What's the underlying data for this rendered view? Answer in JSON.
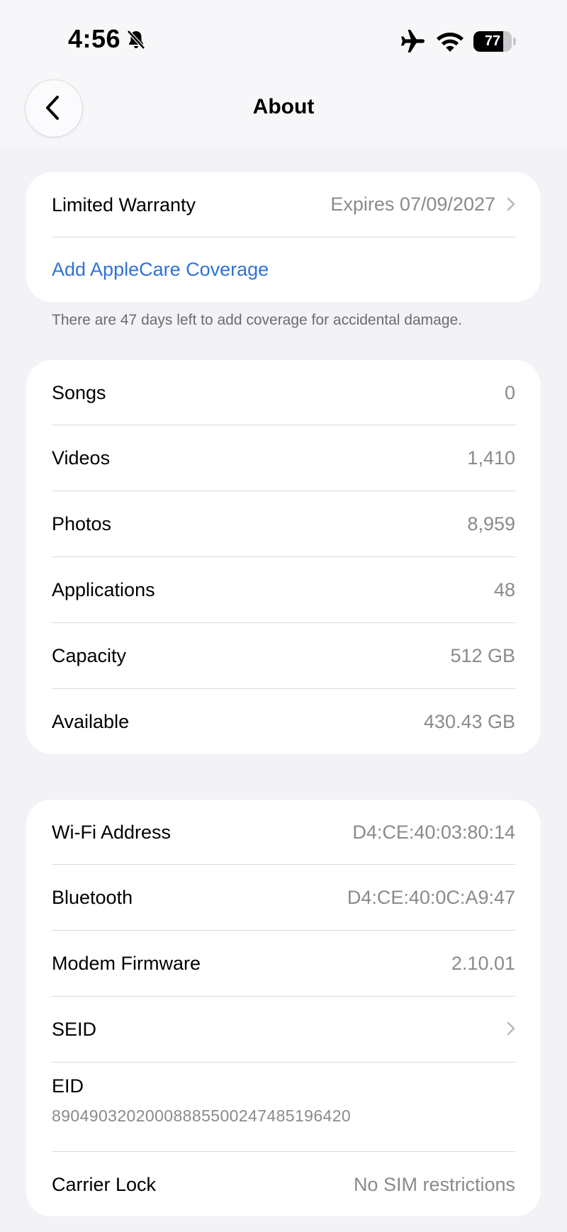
{
  "status": {
    "time": "4:56",
    "battery": "77",
    "battery_level": 0.77
  },
  "nav": {
    "title": "About"
  },
  "warranty": {
    "label": "Limited Warranty",
    "value": "Expires 07/09/2027",
    "applecare_link": "Add AppleCare Coverage",
    "footnote": "There are 47 days left to add coverage for accidental damage."
  },
  "media": {
    "rows": [
      {
        "label": "Songs",
        "value": "0"
      },
      {
        "label": "Videos",
        "value": "1,410"
      },
      {
        "label": "Photos",
        "value": "8,959"
      },
      {
        "label": "Applications",
        "value": "48"
      },
      {
        "label": "Capacity",
        "value": "512 GB"
      },
      {
        "label": "Available",
        "value": "430.43 GB"
      }
    ]
  },
  "device": {
    "wifi": {
      "label": "Wi-Fi Address",
      "value": "D4:CE:40:03:80:14"
    },
    "bluetooth": {
      "label": "Bluetooth",
      "value": "D4:CE:40:0C:A9:47"
    },
    "modem": {
      "label": "Modem Firmware",
      "value": "2.10.01"
    },
    "seid": {
      "label": "SEID"
    },
    "eid": {
      "label": "EID",
      "value": "89049032020008885500247485196420"
    },
    "carrier": {
      "label": "Carrier Lock",
      "value": "No SIM restrictions"
    }
  },
  "colors": {
    "link": "#2f72d6",
    "background": "#f2f2f7",
    "secondary_text": "#8a8a8e"
  }
}
